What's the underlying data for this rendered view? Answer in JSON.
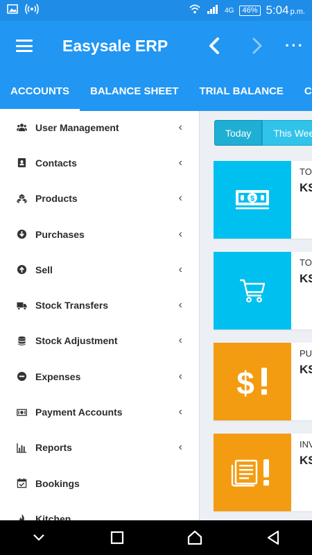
{
  "status_bar": {
    "network": "4G",
    "battery": "46%",
    "time": "5:04",
    "ampm": "p.m."
  },
  "app_bar": {
    "title": "Easysale ERP"
  },
  "tabs": [
    {
      "label": "ACCOUNTS",
      "active": true
    },
    {
      "label": "BALANCE SHEET"
    },
    {
      "label": "TRIAL BALANCE"
    },
    {
      "label": "CASH"
    }
  ],
  "sidebar": {
    "items": [
      {
        "label": "User Management",
        "icon": "users-icon",
        "has_submenu": true
      },
      {
        "label": "Contacts",
        "icon": "address-book-icon",
        "has_submenu": true
      },
      {
        "label": "Products",
        "icon": "cubes-icon",
        "has_submenu": true
      },
      {
        "label": "Purchases",
        "icon": "arrow-circle-down-icon",
        "has_submenu": true
      },
      {
        "label": "Sell",
        "icon": "arrow-circle-up-icon",
        "has_submenu": true
      },
      {
        "label": "Stock Transfers",
        "icon": "truck-icon",
        "has_submenu": true
      },
      {
        "label": "Stock Adjustment",
        "icon": "database-icon",
        "has_submenu": true
      },
      {
        "label": "Expenses",
        "icon": "minus-circle-icon",
        "has_submenu": true
      },
      {
        "label": "Payment Accounts",
        "icon": "money-icon",
        "has_submenu": true
      },
      {
        "label": "Reports",
        "icon": "bar-chart-icon",
        "has_submenu": true
      },
      {
        "label": "Bookings",
        "icon": "calendar-check-icon",
        "has_submenu": false
      },
      {
        "label": "Kitchen",
        "icon": "fire-icon",
        "has_submenu": false
      }
    ],
    "chevron": "‹"
  },
  "main": {
    "date_filter": {
      "options": [
        "Today",
        "This Wee"
      ],
      "selected": "Today"
    },
    "cards": [
      {
        "label": "TO",
        "value": "KS",
        "icon": "money-bill-icon",
        "color": "#00c0ef"
      },
      {
        "label": "TO",
        "value": "KS",
        "icon": "shopping-cart-icon",
        "color": "#00c0ef"
      },
      {
        "label": "PU",
        "value": "KS",
        "icon": "dollar-exclamation-icon",
        "color": "#f39c12"
      },
      {
        "label": "INV",
        "value": "KS",
        "icon": "invoice-exclamation-icon",
        "color": "#f39c12"
      }
    ]
  },
  "colors": {
    "primary": "#2196f3",
    "status_bar": "#1f8de8",
    "info": "#00c0ef",
    "warning": "#f39c12"
  }
}
